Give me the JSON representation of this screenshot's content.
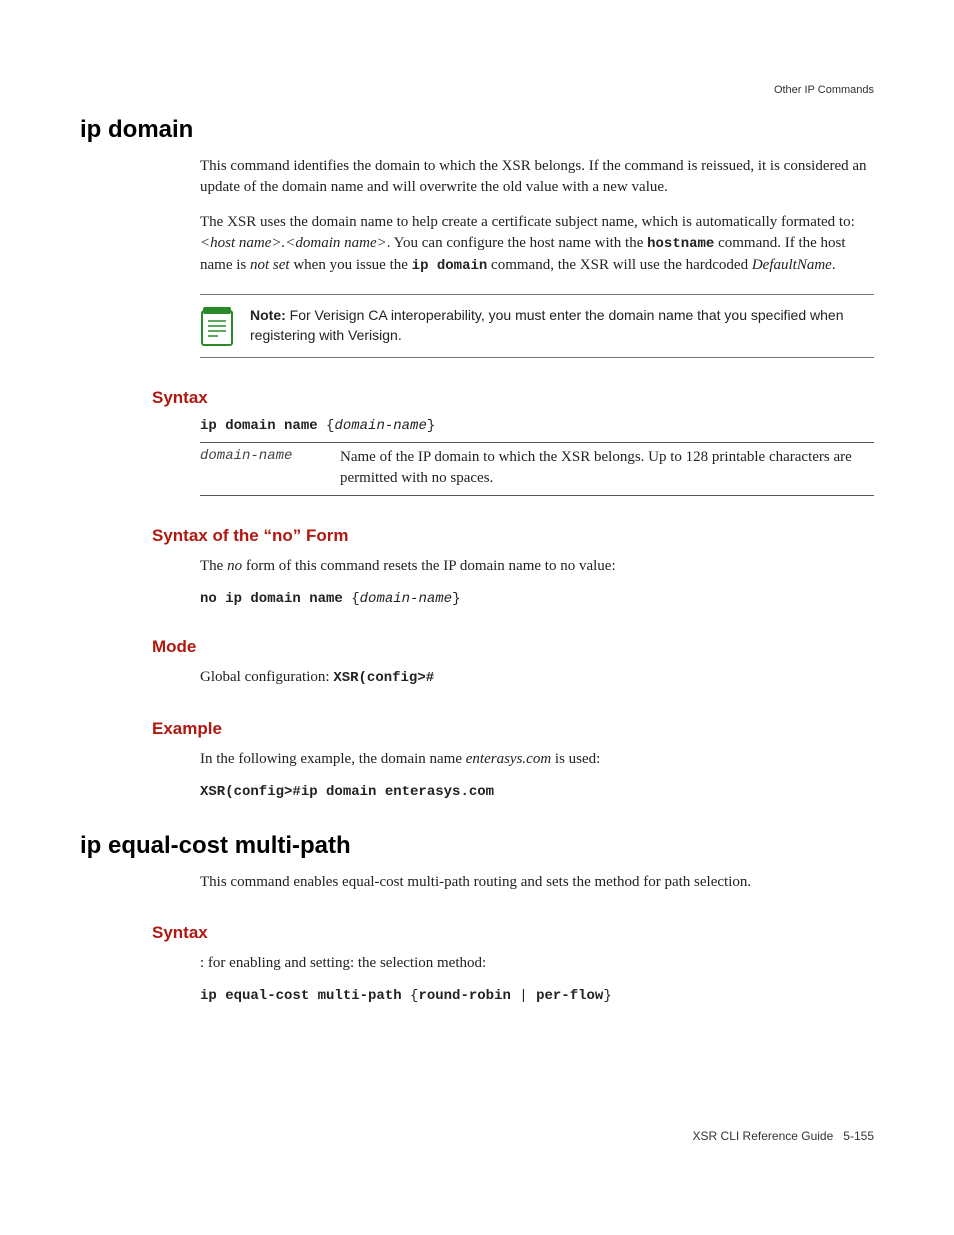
{
  "header": {
    "right": "Other IP Commands"
  },
  "section1": {
    "title": "ip domain",
    "para1_a": "This command identifies the domain to which the XSR belongs. If the command is reissued, it is considered an update of the domain name and will overwrite the old value with a new value.",
    "para2_a": "The XSR uses the domain name to help create a certificate subject name, which is automatically formated to: ",
    "para2_em1": "<host name>.<domain name>",
    "para2_b": ". You can configure the host name with the ",
    "para2_mono1": "hostname",
    "para2_c": " command. If the host name is ",
    "para2_em2": "not set",
    "para2_d": " when you issue the ",
    "para2_mono2": "ip domain",
    "para2_e": " command, the XSR will use the hardcoded ",
    "para2_em3": "DefaultName",
    "para2_f": ".",
    "note_label": "Note:",
    "note_text": " For Verisign CA interoperability, you must enter the domain name that you specified when registering with Verisign.",
    "syntax_heading": "Syntax",
    "syntax_cmd_a": "ip domain name ",
    "syntax_cmd_brace_open": "{",
    "syntax_cmd_it": "domain-name",
    "syntax_cmd_brace_close": "}",
    "param_name": "domain-name",
    "param_desc": "Name of the IP domain to which the XSR belongs. Up to 128 printable characters are permitted with no spaces.",
    "noform_heading": "Syntax of the “no” Form",
    "noform_para_a": "The ",
    "noform_para_em": "no",
    "noform_para_b": " form of this command resets the IP domain name to no value:",
    "noform_cmd_a": "no ip domain name ",
    "mode_heading": "Mode",
    "mode_para_a": "Global configuration: ",
    "mode_mono": "XSR(config>#",
    "example_heading": "Example",
    "example_para_a": "In the following example, the domain name ",
    "example_em": "enterasys.com",
    "example_para_b": " is used:",
    "example_cmd": "XSR(config>#ip domain enterasys.com"
  },
  "section2": {
    "title": "ip equal-cost multi-path",
    "para1": "This command enables equal-cost multi-path routing and sets the method for path selection.",
    "syntax_heading": "Syntax",
    "syntax_para": ": for enabling and setting: the selection method:",
    "syntax_cmd_a": "ip equal-cost multi-path ",
    "syntax_brace_open": "{",
    "syntax_opt1": "round-robin",
    "syntax_pipe": " | ",
    "syntax_opt2": "per-flow",
    "syntax_brace_close": "}"
  },
  "footer": {
    "text_a": "XSR CLI Reference Guide",
    "text_b": "5-155"
  }
}
